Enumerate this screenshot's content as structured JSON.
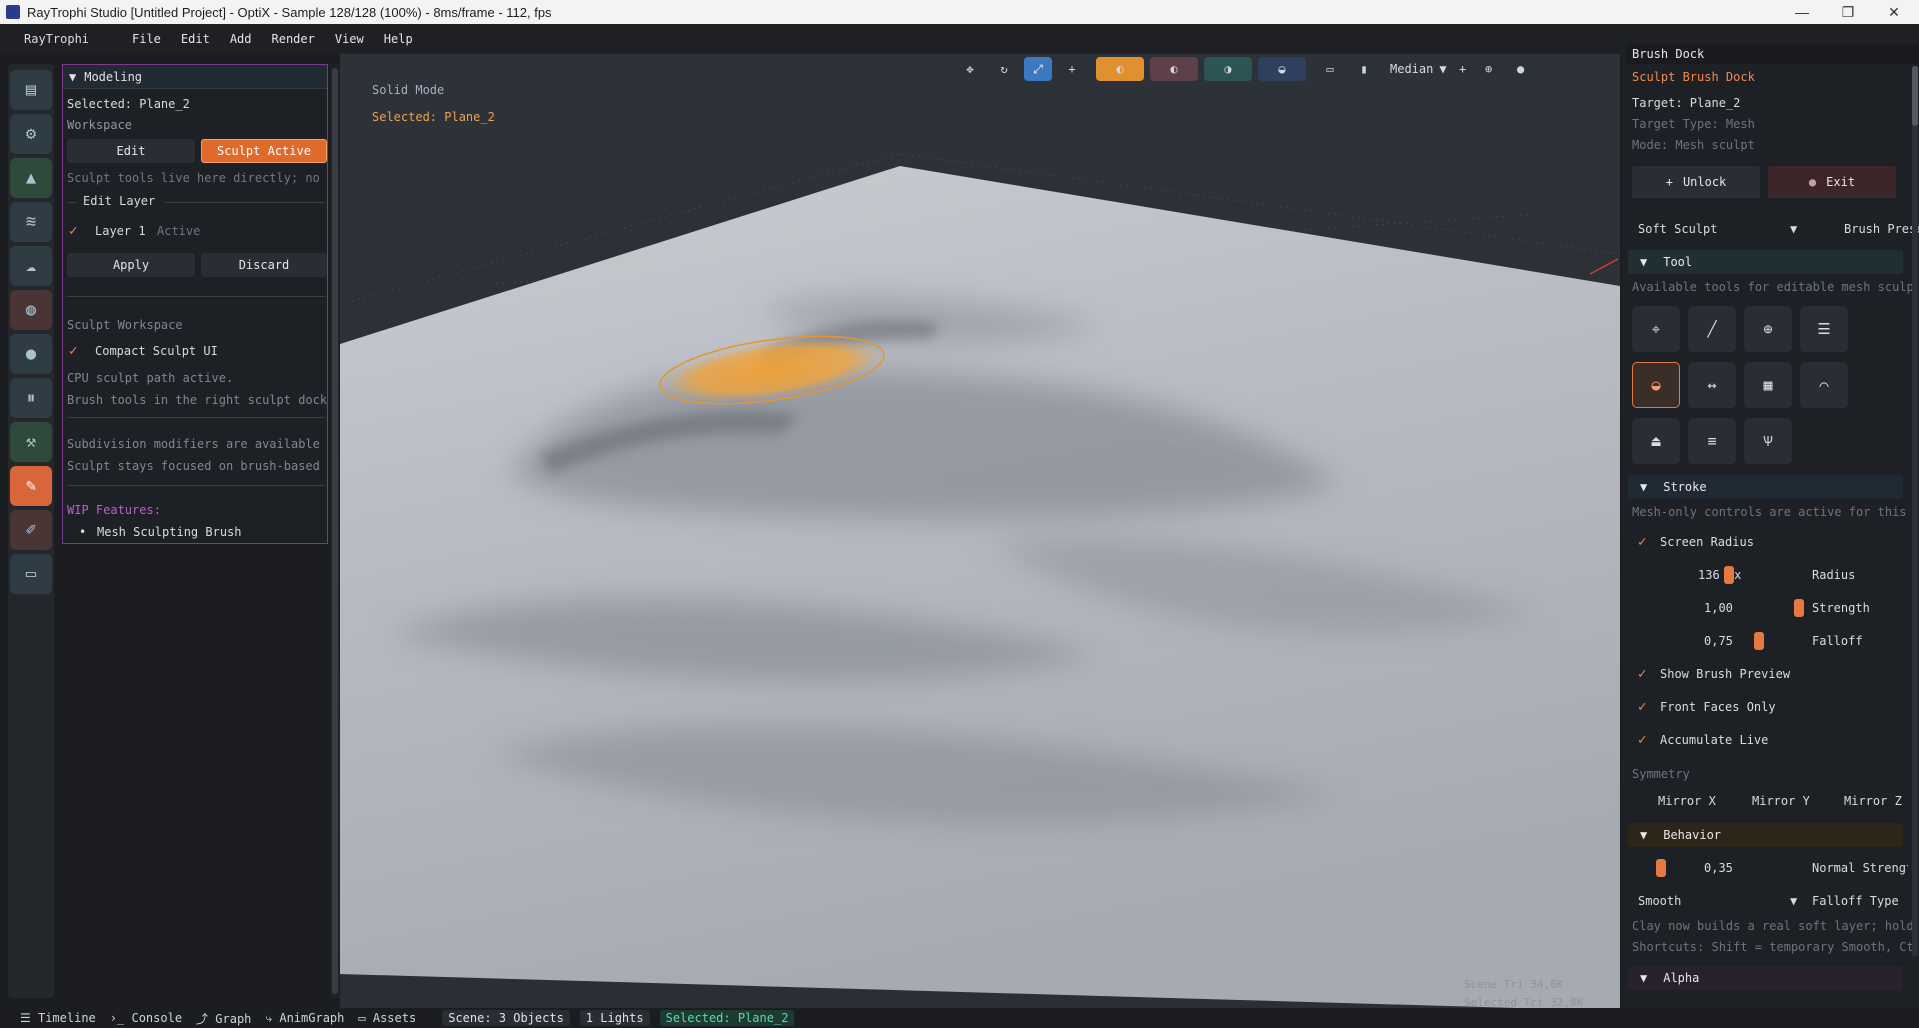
{
  "window": {
    "title": "RayTrophi Studio [Untitled Project] - OptiX - Sample 128/128 (100%) - 8ms/frame - 112, fps",
    "minimize": "—",
    "maximize": "❐",
    "close": "✕"
  },
  "menu": {
    "brand": "RayTrophi",
    "items": [
      "File",
      "Edit",
      "Add",
      "Render",
      "View",
      "Help"
    ]
  },
  "iconbar": {
    "icons": [
      "layers-icon",
      "gear-icon",
      "mountain-icon",
      "waves-icon",
      "cloud-icon",
      "globe-icon",
      "location-icon",
      "pause-icon",
      "hammer-icon",
      "brush-icon",
      "pen-icon",
      "monitor-icon"
    ],
    "active_index": 9
  },
  "left_panel": {
    "header": "Modeling",
    "selected": "Selected: Plane_2",
    "workspace_label": "Workspace",
    "edit_button": "Edit",
    "sculpt_button": "Sculpt Active",
    "sculpt_hint": "Sculpt tools live here directly; no e",
    "edit_layer_label": "Edit Layer",
    "layer_name": "Layer 1",
    "layer_state": "Active",
    "apply_button": "Apply",
    "discard_button": "Discard",
    "sculpt_workspace_label": "Sculpt Workspace",
    "compact_ui_label": "Compact Sculpt UI",
    "cpu_text": "CPU sculpt path active.",
    "brush_tools_text": "Brush tools in the right sculpt dock.",
    "subdiv_text": "Subdivision modifiers are available o",
    "sculpt_focus_text": "Sculpt stays focused on brush-based s",
    "wip_label": "WIP Features:",
    "wip_item": "Mesh Sculpting Brush"
  },
  "viewport": {
    "mode": "Solid Mode",
    "selected": "Selected: Plane_2",
    "median_label": "Median",
    "scene_tri": "Scene Tri   34,8K",
    "selected_tri": "Selected Tri  32,8K"
  },
  "brush_dock": {
    "title": "Brush Dock",
    "header": "Sculpt Brush Dock",
    "target": "Target: Plane_2",
    "target_type": "Target Type: Mesh",
    "mode": "Mode: Mesh sculpt",
    "unlock_button": "Unlock",
    "exit_button": "Exit",
    "preset_value": "Soft Sculpt",
    "preset_label": "Brush Preset",
    "tool_section": "Tool",
    "tool_hint": "Available tools for editable mesh sculp",
    "tools": [
      "crosshair-icon",
      "pen-icon",
      "inflate-icon",
      "layer-icon",
      "clay-icon",
      "move-icon",
      "grid-icon",
      "smooth-icon",
      "flatten-icon",
      "scrape-icon",
      "pinch-icon"
    ],
    "stroke_section": "Stroke",
    "stroke_hint": "Mesh-only controls are active for this",
    "screen_radius": "Screen Radius",
    "radius_value": "136 px",
    "radius_label": "Radius",
    "strength_value": "1,00",
    "strength_label": "Strength",
    "falloff_value": "0,75",
    "falloff_label": "Falloff",
    "show_preview": "Show Brush Preview",
    "front_faces": "Front Faces Only",
    "accumulate": "Accumulate Live",
    "symmetry_label": "Symmetry",
    "mirror_x": "Mirror X",
    "mirror_y": "Mirror Y",
    "mirror_z": "Mirror Z",
    "behavior_section": "Behavior",
    "normal_strength_value": "0,35",
    "normal_strength_label": "Normal Strengt",
    "falloff_type_value": "Smooth",
    "falloff_type_label": "Falloff Type",
    "clay_hint": "Clay now builds a real soft layer; hold",
    "shortcuts_hint": "Shortcuts: Shift = temporary Smooth, Ct",
    "alpha_section": "Alpha"
  },
  "statusbar": {
    "timeline": "Timeline",
    "console": "Console",
    "graph": "Graph",
    "animgraph": "AnimGraph",
    "assets": "Assets",
    "scene_objects": "Scene: 3 Objects",
    "lights": "1 Lights",
    "selected": "Selected: Plane_2"
  }
}
